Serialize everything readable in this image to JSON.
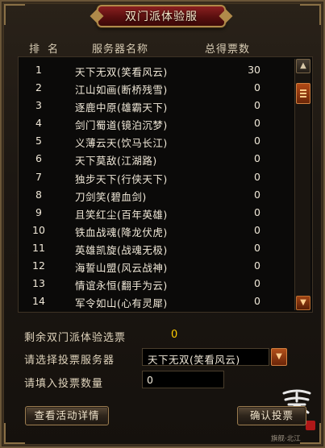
{
  "window": {
    "title": "双门派体验服"
  },
  "table": {
    "headers": {
      "rank": "排名",
      "server": "服务器名称",
      "votes": "总得票数"
    },
    "rows": [
      {
        "rank": "1",
        "server": "天下无双(笑看风云)",
        "votes": "30"
      },
      {
        "rank": "2",
        "server": "江山如画(断桥残雪)",
        "votes": "0"
      },
      {
        "rank": "3",
        "server": "逐鹿中原(雄霸天下)",
        "votes": "0"
      },
      {
        "rank": "4",
        "server": "剑门蜀道(镜泊沉梦)",
        "votes": "0"
      },
      {
        "rank": "5",
        "server": "义薄云天(饮马长江)",
        "votes": "0"
      },
      {
        "rank": "6",
        "server": "天下莫敌(江湖路)",
        "votes": "0"
      },
      {
        "rank": "7",
        "server": "独步天下(行侠天下)",
        "votes": "0"
      },
      {
        "rank": "8",
        "server": "刀剑笑(碧血剑)",
        "votes": "0"
      },
      {
        "rank": "9",
        "server": "且笑红尘(百年英雄)",
        "votes": "0"
      },
      {
        "rank": "10",
        "server": "铁血战魂(降龙伏虎)",
        "votes": "0"
      },
      {
        "rank": "11",
        "server": "英雄凯旋(战魂无极)",
        "votes": "0"
      },
      {
        "rank": "12",
        "server": "海誓山盟(风云战神)",
        "votes": "0"
      },
      {
        "rank": "13",
        "server": "情谊永恒(翻手为云)",
        "votes": "0"
      },
      {
        "rank": "14",
        "server": "军令如山(心有灵犀)",
        "votes": "0"
      }
    ]
  },
  "scrollbar": {
    "up_icon": "▲",
    "down_icon": "▼"
  },
  "form": {
    "remaining_label": "剩余双门派体验选票",
    "remaining_value": "0",
    "server_select_label": "请选择投票服务器",
    "server_select_value": "天下无双(笑看风云)",
    "select_arrow_icon": "▼",
    "quantity_label": "请填入投票数量",
    "quantity_value": "0"
  },
  "buttons": {
    "details": "查看活动详情",
    "confirm": "确认投票"
  },
  "branding": {
    "emblem_glyph": "零",
    "seal_text": "攻",
    "watermark": "旗舰·北江"
  },
  "colors": {
    "accent_orange": "#b24a16",
    "title_red": "#8a2020",
    "value_yellow": "#ffcc00",
    "frame_gold": "#9a7c50"
  }
}
